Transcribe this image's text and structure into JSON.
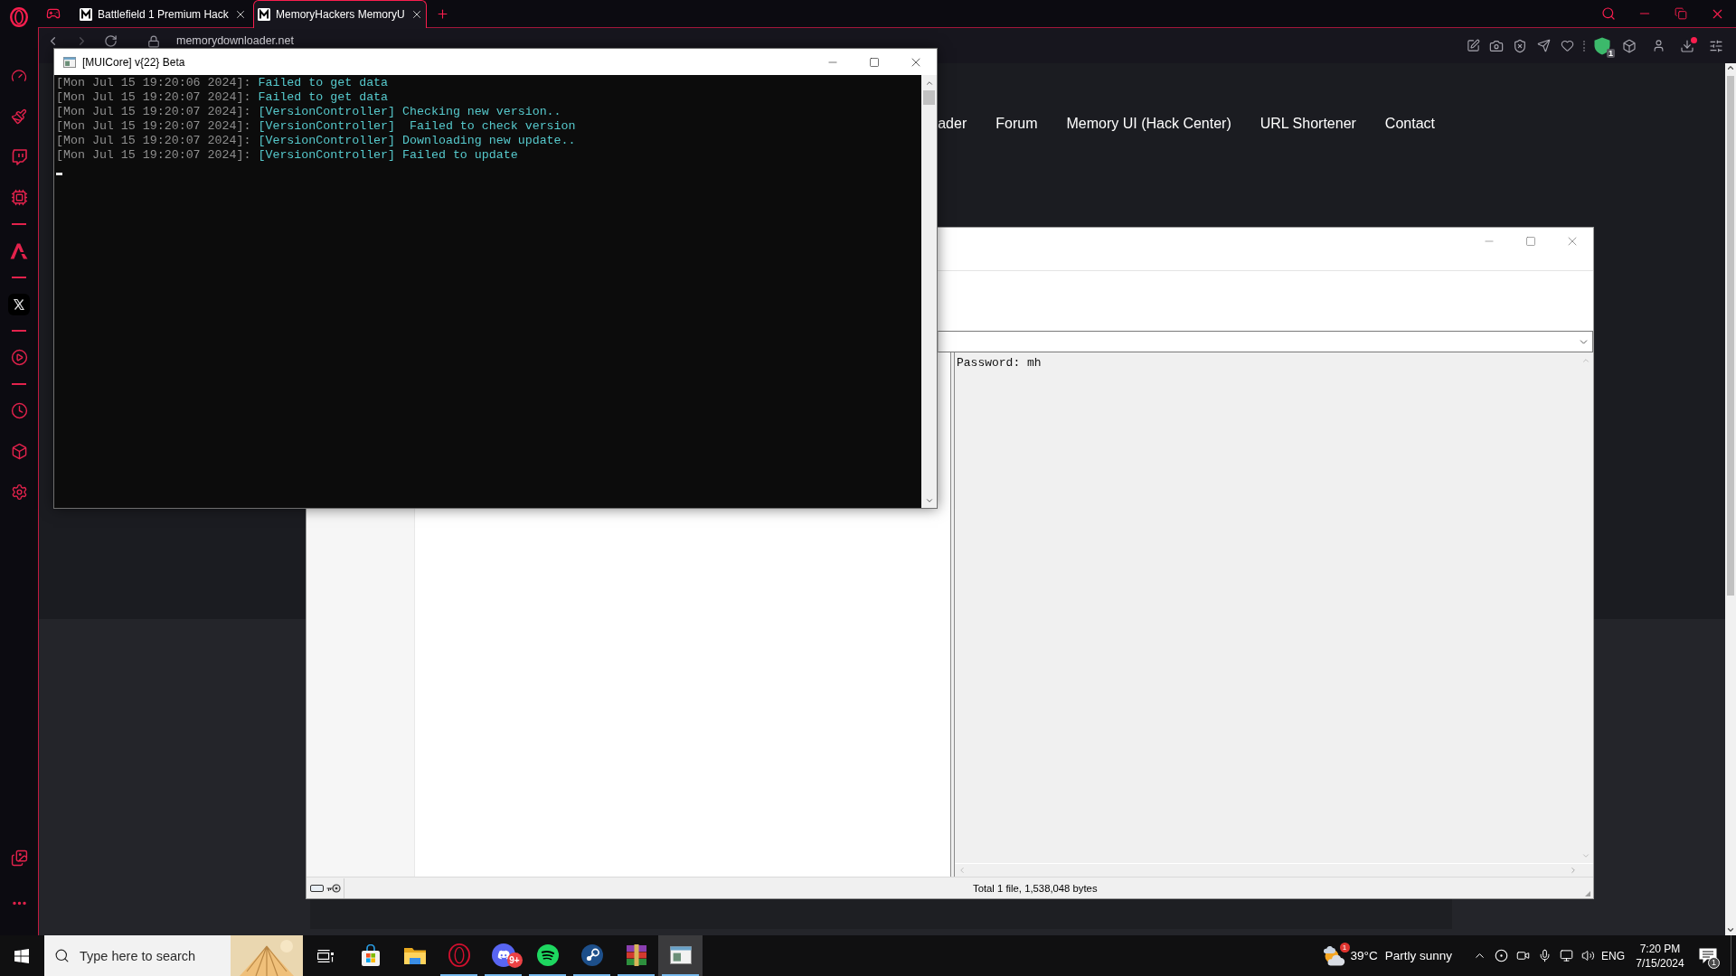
{
  "browser": {
    "tabs": [
      {
        "title": "Battlefield 1 Premium Hack",
        "selected": false
      },
      {
        "title": "MemoryHackers MemoryU",
        "selected": true
      }
    ],
    "address": "memorydownloader.net",
    "shield_badge": "1"
  },
  "page": {
    "nav": [
      "ader",
      "Forum",
      "Memory UI (Hack Center)",
      "URL Shortener",
      "Contact"
    ]
  },
  "console_window": {
    "title": "[MUICore] v{22} Beta",
    "lines": [
      {
        "timestamp": "[Mon Jul 15 19:20:06 2024]:",
        "message": "Failed to get data"
      },
      {
        "timestamp": "[Mon Jul 15 19:20:07 2024]:",
        "message": "Failed to get data"
      },
      {
        "timestamp": "[Mon Jul 15 19:20:07 2024]:",
        "message": "[VersionController] Checking new version.."
      },
      {
        "timestamp": "[Mon Jul 15 19:20:07 2024]:",
        "message": "[VersionController]  Failed to check version"
      },
      {
        "timestamp": "[Mon Jul 15 19:20:07 2024]:",
        "message": "[VersionController] Downloading new update.."
      },
      {
        "timestamp": "[Mon Jul 15 19:20:07 2024]:",
        "message": "[VersionController] Failed to update"
      }
    ]
  },
  "archive_window": {
    "comment": "Password: mh",
    "status": "Total 1 file, 1,538,048 bytes"
  },
  "taskbar": {
    "search": {
      "placeholder": "Type here to search"
    },
    "apps": [
      {
        "kind": "store",
        "running": false,
        "selected": false
      },
      {
        "kind": "explorer",
        "running": false,
        "selected": false
      },
      {
        "kind": "opera",
        "running": true,
        "selected": false
      },
      {
        "kind": "discord",
        "running": true,
        "selected": false,
        "badge": "9+"
      },
      {
        "kind": "spotify",
        "running": true,
        "selected": false
      },
      {
        "kind": "steam",
        "running": true,
        "selected": false
      },
      {
        "kind": "winrar",
        "running": true,
        "selected": false
      },
      {
        "kind": "console",
        "running": true,
        "selected": true
      }
    ],
    "weather": {
      "badge": "1",
      "temperature": "39°C",
      "condition": "Partly sunny"
    },
    "language": "ENG",
    "time": "7:20 PM",
    "date": "7/15/2024",
    "notification_count": "1"
  }
}
